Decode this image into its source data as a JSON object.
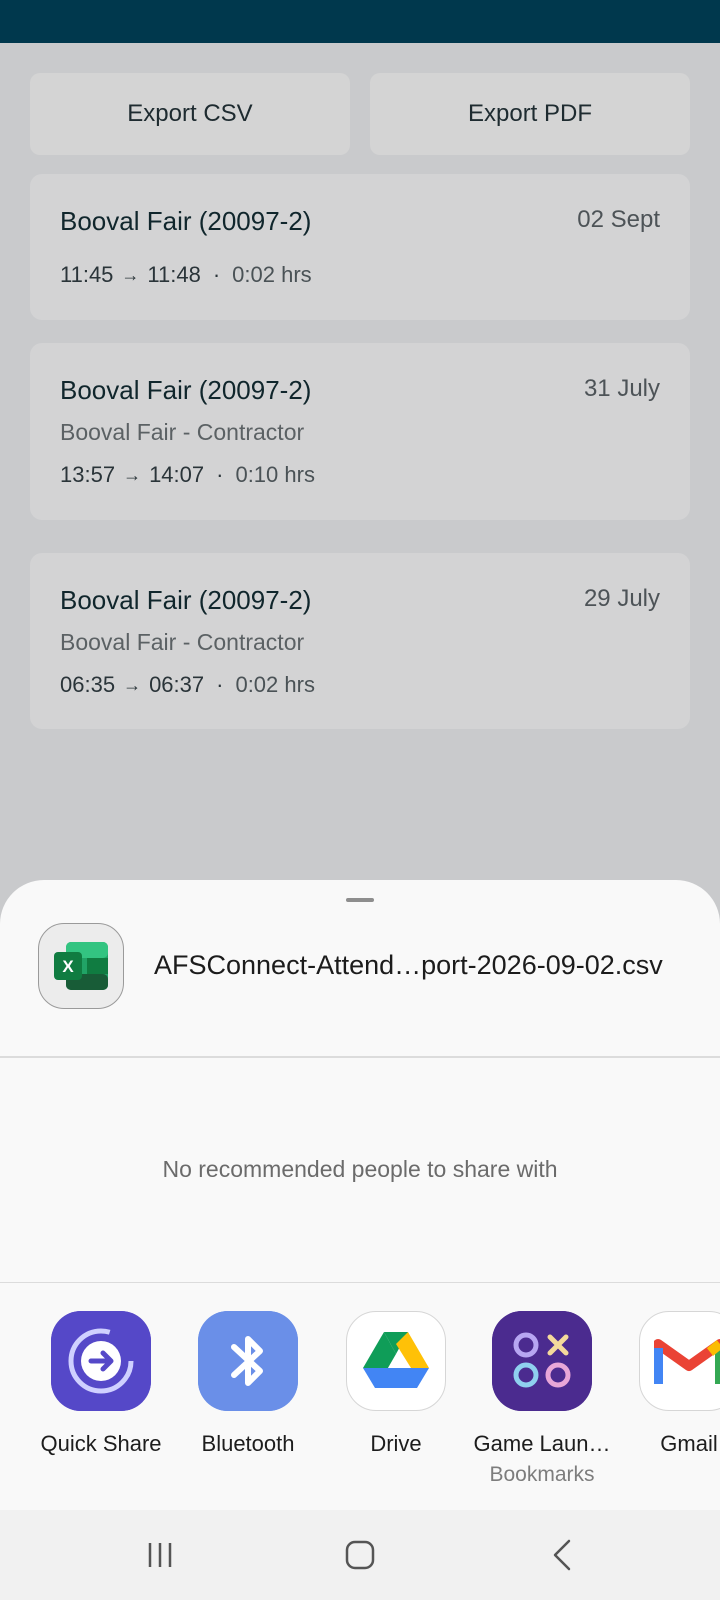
{
  "export": {
    "csv_label": "Export CSV",
    "pdf_label": "Export PDF"
  },
  "records": [
    {
      "title": "Booval Fair (20097-2)",
      "date": "02 Sept",
      "subtitle": "",
      "start": "11:45",
      "end": "11:48",
      "duration": "0:02 hrs"
    },
    {
      "title": "Booval Fair (20097-2)",
      "date": "31 July",
      "subtitle": "Booval Fair - Contractor",
      "start": "13:57",
      "end": "14:07",
      "duration": "0:10 hrs"
    },
    {
      "title": "Booval Fair (20097-2)",
      "date": "29 July",
      "subtitle": "Booval Fair - Contractor",
      "start": "06:35",
      "end": "06:37",
      "duration": "0:02 hrs"
    }
  ],
  "share": {
    "file_icon": "excel-file-icon",
    "file_name": "AFSConnect-Attend…port-2026-09-02.csv",
    "no_people": "No recommended people to share with",
    "apps": [
      {
        "icon": "quick-share-icon",
        "label": "Quick Share",
        "sub": ""
      },
      {
        "icon": "bluetooth-icon",
        "label": "Bluetooth",
        "sub": ""
      },
      {
        "icon": "drive-icon",
        "label": "Drive",
        "sub": ""
      },
      {
        "icon": "game-launcher-icon",
        "label": "Game Laun…",
        "sub": "Bookmarks"
      },
      {
        "icon": "gmail-icon",
        "label": "Gmail",
        "sub": ""
      }
    ]
  },
  "navbar": {
    "recents": "recents-icon",
    "home": "home-icon",
    "back": "back-icon"
  },
  "colors": {
    "header": "#00384d",
    "overlay_bg": "#c9cacc",
    "sheet_bg": "#f9f9f9"
  }
}
